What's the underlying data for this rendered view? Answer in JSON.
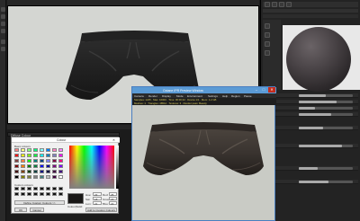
{
  "app": {
    "viewport_bg": "#d4d6d2",
    "accent": "#5b9bd5"
  },
  "right_panel": {
    "tabs": [
      "",
      "",
      "",
      ""
    ],
    "properties": [
      {
        "label": "",
        "level": 0.5
      },
      {
        "label": "",
        "level": 0.7
      },
      {
        "label": "",
        "level": 0.3
      },
      {
        "label": "",
        "level": 0.6
      },
      {
        "label": "",
        "level": 0.45
      },
      {
        "label": "",
        "level": 0.8
      },
      {
        "label": "",
        "level": 0.35
      },
      {
        "label": "",
        "level": 0.55
      }
    ]
  },
  "color_dialog": {
    "outer_title": "Diffuse Colour",
    "title": "Colour",
    "basic_colors_label": "Basic colours",
    "custom_colors_label": "Custom colours",
    "add_custom_label": "Add to Custom Colours",
    "define_label": "Define Custom Colours >>",
    "ok_label": "OK",
    "cancel_label": "Cancel",
    "hue_label": "Hue:",
    "hue_value": "23",
    "sat_label": "Sat:",
    "sat_value": "18",
    "lum_label": "Lum:",
    "lum_value": "21",
    "red_label": "Red:",
    "red_value": "25",
    "green_label": "Green:",
    "green_value": "23",
    "blue_label": "Blue:",
    "blue_value": "22",
    "colour_solid_label": "Colour|Solid",
    "selected_color": "#191716"
  },
  "uv_window": {
    "title": "Octane IPR Preview Window",
    "minimize": "–",
    "maximize": "□",
    "close": "✕",
    "menus": [
      "Camera",
      "Render",
      "Display",
      "Mode",
      "Environment",
      "Settings",
      "Help",
      "Region",
      "Pause"
    ],
    "status_line1": "Samples: 1245 · Max: 16000 · Time: 00:00:42 · Device 1/1 · Mem: 1.2 GB",
    "status_line2": "Meshes: 1 · Triangles: 48512 · Textures: 3 · Render pass: Beauty"
  },
  "icons": {
    "close": "close-icon",
    "minimize": "minimize-icon",
    "maximize": "maximize-icon"
  }
}
